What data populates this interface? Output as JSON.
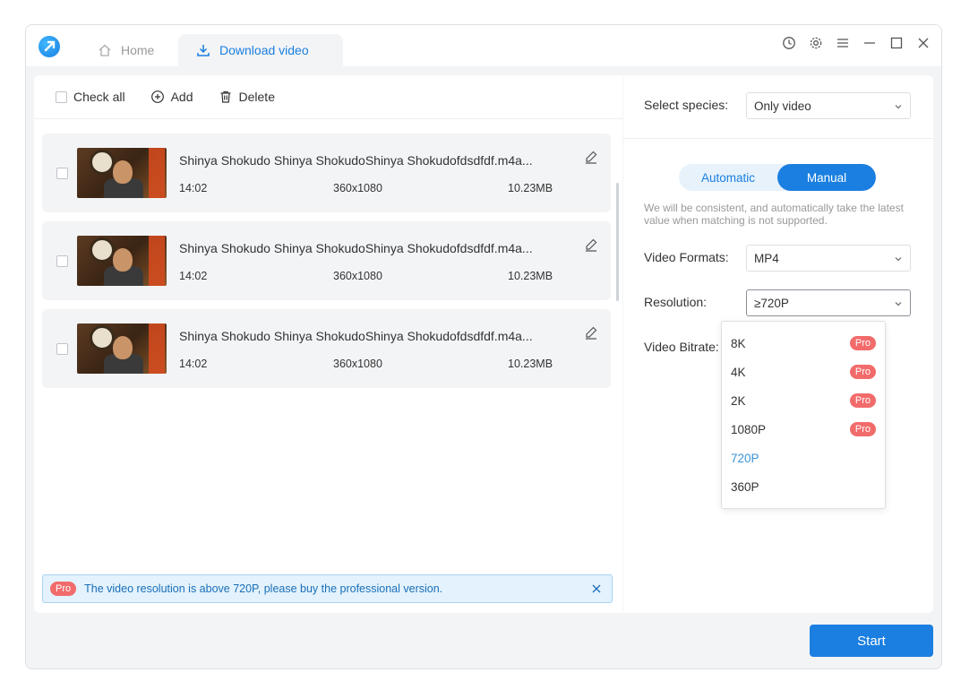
{
  "titlebar": {
    "tabs": [
      {
        "label": "Home",
        "icon": "home-icon"
      },
      {
        "label": "Download video",
        "icon": "download-icon"
      }
    ],
    "controls": [
      "history-icon",
      "gear-icon",
      "menu-icon",
      "minimize-icon",
      "maximize-icon",
      "close-icon"
    ]
  },
  "toolbar": {
    "check_all": "Check all",
    "add": "Add",
    "delete": "Delete"
  },
  "videos": [
    {
      "title": "Shinya Shokudo Shinya ShokudoShinya Shokudofdsdfdf.m4a...",
      "duration": "14:02",
      "resolution": "360x1080",
      "size": "10.23MB"
    },
    {
      "title": "Shinya Shokudo Shinya ShokudoShinya Shokudofdsdfdf.m4a...",
      "duration": "14:02",
      "resolution": "360x1080",
      "size": "10.23MB"
    },
    {
      "title": "Shinya Shokudo Shinya ShokudoShinya Shokudofdsdfdf.m4a...",
      "duration": "14:02",
      "resolution": "360x1080",
      "size": "10.23MB"
    }
  ],
  "notice": {
    "badge": "Pro",
    "text": "The video resolution is above 720P, please buy the professional version."
  },
  "settings": {
    "species_label": "Select species:",
    "species_value": "Only video",
    "mode_auto": "Automatic",
    "mode_manual": "Manual",
    "hint": "We will be consistent, and automatically take the latest value when matching is not supported.",
    "format_label": "Video Formats:",
    "format_value": "MP4",
    "resolution_label": "Resolution:",
    "resolution_value": "≥720P",
    "bitrate_label": "Video Bitrate:"
  },
  "resolution_options": [
    {
      "label": "8K",
      "badge": "Pro"
    },
    {
      "label": "4K",
      "badge": "Pro"
    },
    {
      "label": "2K",
      "badge": "Pro"
    },
    {
      "label": "1080P",
      "badge": "Pro"
    },
    {
      "label": "720P",
      "badge": ""
    },
    {
      "label": "360P",
      "badge": ""
    }
  ],
  "start_button": "Start",
  "colors": {
    "accent": "#1a7fe0",
    "pro": "#f26b6b",
    "notice_bg": "#e3f2fc"
  }
}
